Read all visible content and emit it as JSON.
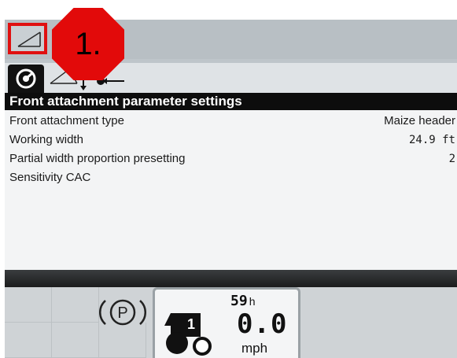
{
  "callout": {
    "label": "1."
  },
  "panel": {
    "title": "Front attachment parameter settings"
  },
  "params": [
    {
      "label": "Front attachment type",
      "value": "Maize header"
    },
    {
      "label": "Working width",
      "value": "24.9 ft"
    },
    {
      "label": "Partial width proportion presetting",
      "value": "2"
    },
    {
      "label": "Sensitivity CAC",
      "value": ""
    }
  ],
  "status": {
    "parking_brake": "P",
    "hours_value": "59",
    "hours_unit": "h",
    "speed_value": "0.0",
    "speed_unit": "mph",
    "gear": "1"
  },
  "icons": {
    "menu": "header-tilt-icon",
    "tab_active": "gauge-icon",
    "tab_2": "header-lower-icon",
    "tab_3": "reel-position-icon",
    "park": "parking-brake-icon",
    "vehicle": "tractor-icon"
  },
  "colors": {
    "highlight": "#e01010",
    "title_bar": "#0d0d0d",
    "screen_bg": "#bfc6cb"
  }
}
